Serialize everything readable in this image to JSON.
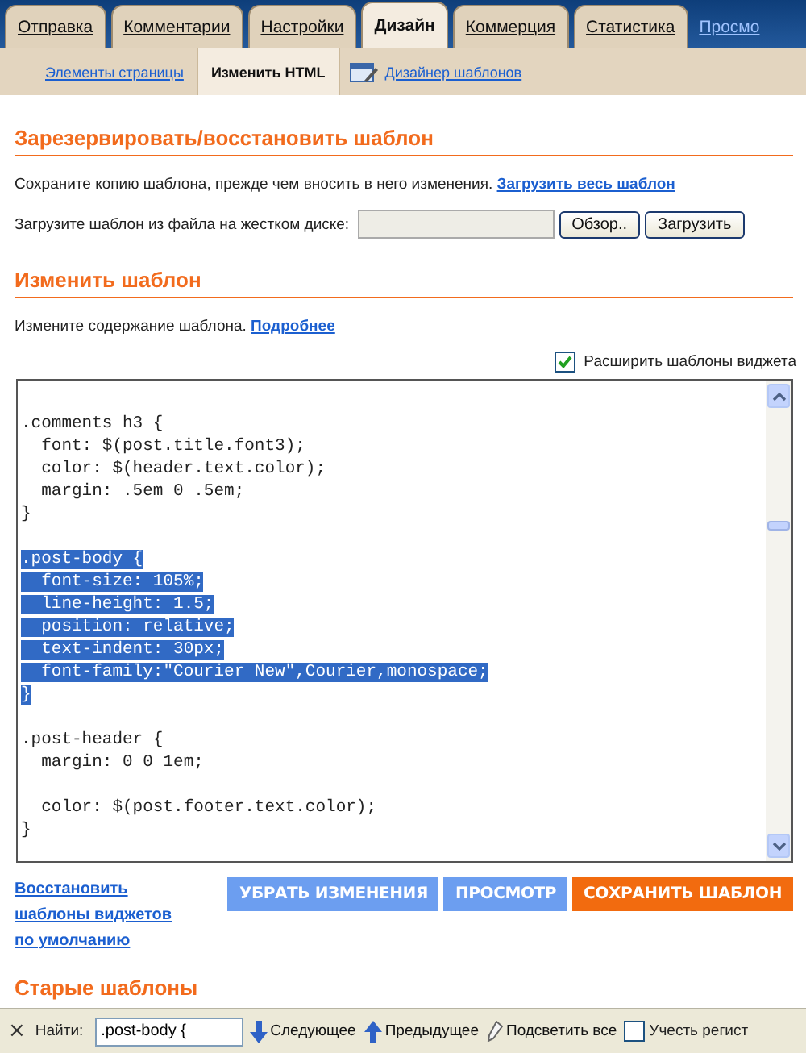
{
  "tabs": [
    {
      "label": "Отправка",
      "selected": false
    },
    {
      "label": "Комментарии",
      "selected": false
    },
    {
      "label": "Настройки",
      "selected": false
    },
    {
      "label": "Дизайн",
      "selected": true
    },
    {
      "label": "Коммерция",
      "selected": false
    },
    {
      "label": "Статистика",
      "selected": false
    }
  ],
  "tab_link": "Просмо",
  "subtabs": [
    {
      "label": "Элементы страницы",
      "selected": false,
      "kind": "link"
    },
    {
      "label": "Изменить HTML",
      "selected": true,
      "kind": "link"
    },
    {
      "label": "Дизайнер шаблонов",
      "selected": false,
      "kind": "designer"
    }
  ],
  "backup": {
    "heading": "Зарезервировать/восстановить шаблон",
    "text": "Сохраните копию шаблона, прежде чем вносить в него изменения.",
    "link": "Загрузить весь шаблон",
    "upload_label": "Загрузите шаблон из файла на жестком диске:",
    "browse_button": "Обзор..",
    "upload_button": "Загрузить"
  },
  "edit": {
    "heading": "Изменить шаблон",
    "text": "Измените содержание шаблона.",
    "link": "Подробнее",
    "expand_label": "Расширить шаблоны виджета",
    "expand_checked": true
  },
  "code_lines": [
    {
      "kind": "blank"
    },
    {
      "kind": "code",
      "text": ".comments h3 {",
      "selected": false
    },
    {
      "kind": "code",
      "text": "  font: $(post.title.font3);",
      "selected": false
    },
    {
      "kind": "code",
      "text": "  color: $(header.text.color);",
      "selected": false
    },
    {
      "kind": "code",
      "text": "  margin: .5em 0 .5em;",
      "selected": false
    },
    {
      "kind": "code",
      "text": "}",
      "selected": false
    },
    {
      "kind": "blank"
    },
    {
      "kind": "code",
      "text": ".post-body {",
      "selected": true
    },
    {
      "kind": "code",
      "text": "  font-size: 105%;",
      "selected": true
    },
    {
      "kind": "code",
      "text": "  line-height: 1.5;",
      "selected": true
    },
    {
      "kind": "code",
      "text": "  position: relative;",
      "selected": true
    },
    {
      "kind": "code",
      "text": "  text-indent: 30px;",
      "selected": true
    },
    {
      "kind": "code",
      "text": "  font-family:\"Courier New\",Courier,monospace;",
      "selected": true
    },
    {
      "kind": "code",
      "text": "}",
      "selected": true
    },
    {
      "kind": "blank"
    },
    {
      "kind": "code",
      "text": ".post-header {",
      "selected": false
    },
    {
      "kind": "code",
      "text": "  margin: 0 0 1em;",
      "selected": false
    },
    {
      "kind": "blank"
    },
    {
      "kind": "code",
      "text": "  color: $(post.footer.text.color);",
      "selected": false
    },
    {
      "kind": "code",
      "text": "}",
      "selected": false
    }
  ],
  "restore_link": "Восстановить шаблоны виджетов по умолчанию",
  "buttons": [
    {
      "label": "УБРАТЬ ИЗМЕНЕНИЯ",
      "kind": "secondary"
    },
    {
      "label": "ПРОСМОТР",
      "kind": "secondary"
    },
    {
      "label": "СОХРАНИТЬ ШАБЛОН",
      "kind": "primary"
    }
  ],
  "old_heading": "Старые шаблоны",
  "find_bar": {
    "close": "×",
    "label": "Найти:",
    "value": ".post-body {",
    "next": "Следующее",
    "prev": "Предыдущее",
    "highlight": "Подсветить все",
    "match_case": "Учесть регист",
    "match_case_checked": false
  }
}
